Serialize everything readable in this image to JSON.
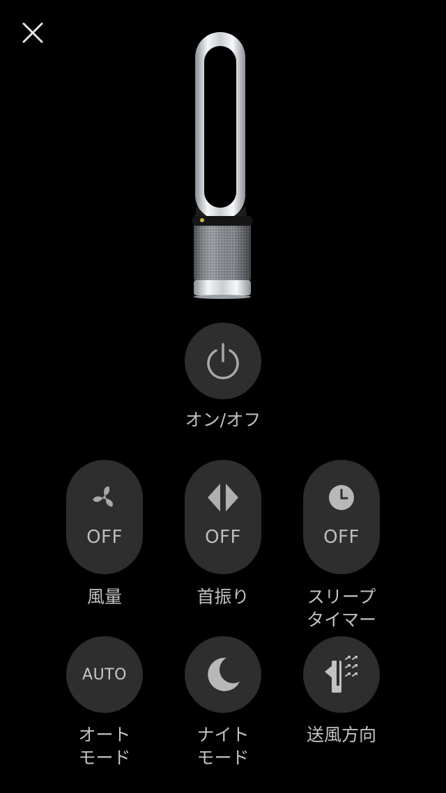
{
  "header": {
    "close_icon": "close-icon"
  },
  "product": {
    "image": "dyson-tower-fan-image"
  },
  "power": {
    "icon": "power-icon",
    "label": "オン/オフ"
  },
  "controls_row1": [
    {
      "icon": "fan-icon",
      "state": "OFF",
      "label": "風量"
    },
    {
      "icon": "oscillation-icon",
      "state": "OFF",
      "label": "首振り"
    },
    {
      "icon": "clock-icon",
      "state": "OFF",
      "label": "スリープ\nタイマー"
    }
  ],
  "controls_row2": [
    {
      "icon_text": "AUTO",
      "label": "オート\nモード"
    },
    {
      "icon": "moon-icon",
      "label": "ナイト\nモード"
    },
    {
      "icon": "airflow-direction-icon",
      "label": "送風方向"
    }
  ],
  "colors": {
    "background": "#000000",
    "button": "#2e2e2e",
    "text": "#c2c2c2"
  }
}
